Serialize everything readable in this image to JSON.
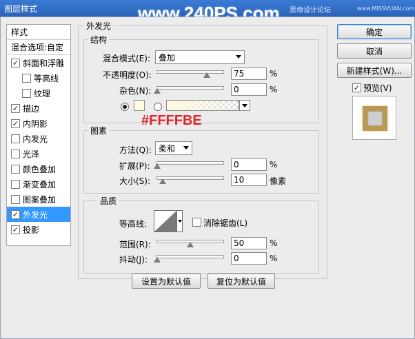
{
  "window": {
    "title": "图层样式",
    "watermark_big": "www.240PS.com",
    "watermark_site": "思缘设计论坛",
    "watermark_url": "www.MISSVUAN.com"
  },
  "style_list": {
    "header": "样式",
    "blend_options": "混合选项:自定",
    "items": [
      {
        "label": "斜面和浮雕",
        "checked": true
      },
      {
        "label": "等高线",
        "checked": false
      },
      {
        "label": "纹理",
        "checked": false
      },
      {
        "label": "描边",
        "checked": true
      },
      {
        "label": "内阴影",
        "checked": true
      },
      {
        "label": "内发光",
        "checked": false
      },
      {
        "label": "光泽",
        "checked": false
      },
      {
        "label": "颜色叠加",
        "checked": false
      },
      {
        "label": "渐变叠加",
        "checked": false
      },
      {
        "label": "图案叠加",
        "checked": false
      },
      {
        "label": "外发光",
        "checked": true
      },
      {
        "label": "投影",
        "checked": true
      }
    ]
  },
  "outer_glow": {
    "title": "外发光",
    "structure": {
      "legend": "结构",
      "blend_mode_label": "混合模式(E):",
      "blend_mode_value": "叠加",
      "opacity_label": "不透明度(O):",
      "opacity_value": "75",
      "noise_label": "杂色(N):",
      "noise_value": "0",
      "percent": "%",
      "color_hex": "#fffbe0",
      "color_annotation": "#FFFFBE"
    },
    "elements": {
      "legend": "图素",
      "technique_label": "方法(Q):",
      "technique_value": "柔和",
      "spread_label": "扩展(P):",
      "spread_value": "0",
      "size_label": "大小(S):",
      "size_value": "10",
      "size_unit": "像素",
      "percent": "%"
    },
    "quality": {
      "legend": "品质",
      "contour_label": "等高线:",
      "antialias_label": "消除锯齿(L)",
      "range_label": "范围(R):",
      "range_value": "50",
      "jitter_label": "抖动(J):",
      "jitter_value": "0",
      "percent": "%"
    },
    "set_default": "设置为默认值",
    "reset_default": "复位为默认值"
  },
  "actions": {
    "ok": "确定",
    "cancel": "取消",
    "new_style": "新建样式(W)...",
    "preview_label": "预览(V)"
  }
}
